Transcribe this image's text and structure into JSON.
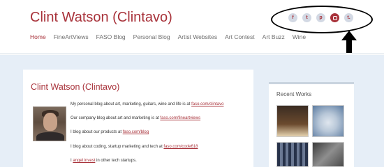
{
  "header": {
    "site_title": "Clint Watson (Clintavo)",
    "nav": [
      {
        "label": "Home",
        "active": true
      },
      {
        "label": "FineArtViews",
        "active": false
      },
      {
        "label": "FASO Blog",
        "active": false
      },
      {
        "label": "Personal Blog",
        "active": false
      },
      {
        "label": "Artist Websites",
        "active": false
      },
      {
        "label": "Art Contest",
        "active": false
      },
      {
        "label": "Art Buzz",
        "active": false
      },
      {
        "label": "Wine",
        "active": false
      }
    ],
    "social": [
      {
        "icon": "facebook-icon",
        "glyph": "f"
      },
      {
        "icon": "twitter-icon",
        "glyph": "t"
      },
      {
        "icon": "pinterest-icon",
        "glyph": "p"
      },
      {
        "icon": "instagram-icon",
        "glyph": ""
      },
      {
        "icon": "tumblr-icon",
        "glyph": "t."
      }
    ]
  },
  "main": {
    "title": "Clint Watson (Clintavo)",
    "paragraphs": [
      {
        "text": "My personal blog about art, marketing, guitars, wine and life is at ",
        "link": "faso.com/clintavo",
        "tail": ""
      },
      {
        "text": "Our company blog about art and marketing is at ",
        "link": "faso.com/fineartviews",
        "tail": ""
      },
      {
        "text": "I blog about our products at ",
        "link": "faso.com/blog",
        "tail": ""
      },
      {
        "text": "I blog about coding, startup marketing and tech at ",
        "link": "faso.com/code618",
        "tail": ""
      },
      {
        "text": "I ",
        "link": "angel invest",
        "tail": " in other tech startups."
      }
    ]
  },
  "sidebar": {
    "title": "Recent Works"
  },
  "colors": {
    "accent": "#a8323a",
    "page_background": "#e6eef7",
    "nav_text": "#6d6d6d"
  }
}
